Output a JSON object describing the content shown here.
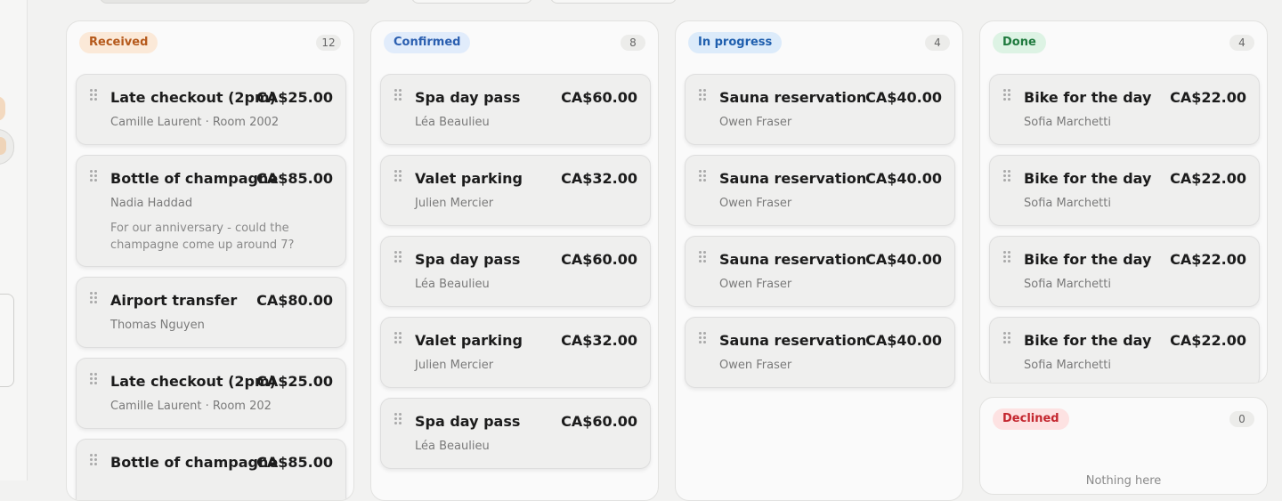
{
  "columns": [
    {
      "status": "Received",
      "count": "12",
      "badge_bg": "#fbe9d8",
      "badge_fg": "#b5591b",
      "cards": [
        {
          "title": "Late checkout (2pm)",
          "price": "CA$25.00",
          "sub": "Camille Laurent · Room 2002"
        },
        {
          "title": "Bottle of champagne",
          "price": "CA$85.00",
          "sub": "Nadia Haddad",
          "note": "For our anniversary - could the champagne come up around 7?"
        },
        {
          "title": "Airport transfer",
          "price": "CA$80.00",
          "sub": "Thomas Nguyen"
        },
        {
          "title": "Late checkout (2pm)",
          "price": "CA$25.00",
          "sub": "Camille Laurent · Room 202"
        },
        {
          "title": "Bottle of champagne",
          "price": "CA$85.00",
          "sub": ""
        }
      ]
    },
    {
      "status": "Confirmed",
      "count": "8",
      "badge_bg": "#e1ecfb",
      "badge_fg": "#2b5fb0",
      "cards": [
        {
          "title": "Spa day pass",
          "price": "CA$60.00",
          "sub": "Léa Beaulieu"
        },
        {
          "title": "Valet parking",
          "price": "CA$32.00",
          "sub": "Julien Mercier"
        },
        {
          "title": "Spa day pass",
          "price": "CA$60.00",
          "sub": "Léa Beaulieu"
        },
        {
          "title": "Valet parking",
          "price": "CA$32.00",
          "sub": "Julien Mercier"
        },
        {
          "title": "Spa day pass",
          "price": "CA$60.00",
          "sub": "Léa Beaulieu"
        }
      ]
    },
    {
      "status": "In progress",
      "count": "4",
      "badge_bg": "#dcebfa",
      "badge_fg": "#1f5fae",
      "cards": [
        {
          "title": "Sauna reservation",
          "price": "CA$40.00",
          "sub": "Owen Fraser"
        },
        {
          "title": "Sauna reservation",
          "price": "CA$40.00",
          "sub": "Owen Fraser"
        },
        {
          "title": "Sauna reservation",
          "price": "CA$40.00",
          "sub": "Owen Fraser"
        },
        {
          "title": "Sauna reservation",
          "price": "CA$40.00",
          "sub": "Owen Fraser"
        }
      ]
    },
    {
      "status": "Done",
      "count": "4",
      "badge_bg": "#ddf3e4",
      "badge_fg": "#1f7a3e",
      "cards": [
        {
          "title": "Bike for the day",
          "price": "CA$22.00",
          "sub": "Sofia Marchetti"
        },
        {
          "title": "Bike for the day",
          "price": "CA$22.00",
          "sub": "Sofia Marchetti"
        },
        {
          "title": "Bike for the day",
          "price": "CA$22.00",
          "sub": "Sofia Marchetti"
        },
        {
          "title": "Bike for the day",
          "price": "CA$22.00",
          "sub": "Sofia Marchetti"
        }
      ]
    },
    {
      "status": "Declined",
      "count": "0",
      "badge_bg": "#fde2e2",
      "badge_fg": "#c4262e",
      "empty_text": "Nothing here",
      "cards": []
    }
  ]
}
